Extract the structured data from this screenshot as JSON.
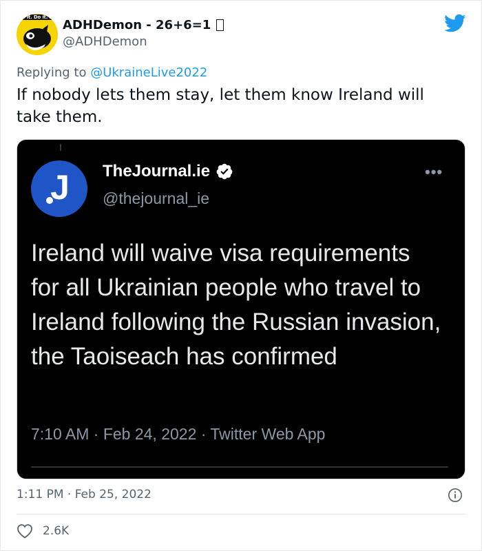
{
  "author": {
    "avatar_caption": "Do it. Do it. Do",
    "display_name": "ADHDemon - 26+6=1",
    "handle": "@ADHDemon"
  },
  "reply_to": {
    "prefix": "Replying to ",
    "mention": "@UkraineLive2022"
  },
  "tweet_text": "If nobody lets them stay, let them know Ireland will take them.",
  "embedded": {
    "avatar_letter": "J",
    "name": "TheJournal.ie",
    "handle": "@thejournal_ie",
    "more": "•••",
    "body": "Ireland will waive visa requirements for all Ukrainian people who travel to Ireland following the Russian invasion, the Taoiseach has confirmed",
    "meta": "7:10 AM · Feb 24, 2022 · Twitter Web App"
  },
  "timestamp": "1:11 PM · Feb 25, 2022",
  "likes": "2.6K",
  "icons": {
    "brand": "twitter-bird-icon",
    "verified": "verified-badge-icon",
    "info": "info-icon",
    "like": "heart-icon"
  },
  "colors": {
    "twitter_blue": "#1d9bf0",
    "muted_text": "#536471",
    "journal_blue": "#1f55c7"
  }
}
